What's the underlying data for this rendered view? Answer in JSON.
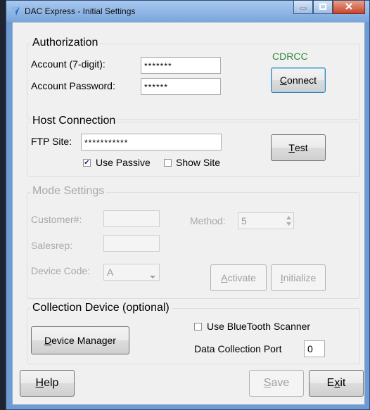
{
  "window": {
    "title": "DAC Express - Initial Settings"
  },
  "authorization": {
    "group_title": "Authorization",
    "account_label": "Account (7-digit):",
    "account_value": "*******",
    "password_label": "Account Password:",
    "password_value": "******",
    "status_text": "CDRCC",
    "connect_button": {
      "mnemonic": "C",
      "rest": "onnect"
    }
  },
  "host": {
    "group_title": "Host Connection",
    "ftp_label": "FTP Site:",
    "ftp_value": "***********",
    "use_passive_label": "Use Passive",
    "use_passive_checked": true,
    "show_site_label": "Show Site",
    "show_site_checked": false,
    "test_button": {
      "mnemonic": "T",
      "rest": "est"
    }
  },
  "mode": {
    "group_title": "Mode Settings",
    "customer_label": "Customer#:",
    "customer_value": "",
    "salesrep_label": "Salesrep:",
    "salesrep_value": "",
    "method_label": "Method:",
    "method_value": "5",
    "device_code_label": "Device Code:",
    "device_code_value": "A",
    "activate_button": {
      "mnemonic": "A",
      "rest": "ctivate"
    },
    "initialize_button": {
      "mnemonic": "I",
      "rest": "nitialize"
    }
  },
  "collection": {
    "group_title": "Collection Device (optional)",
    "device_manager_button": {
      "mnemonic": "D",
      "rest": "evice Manager"
    },
    "bluetooth_label": "Use BlueTooth Scanner",
    "bluetooth_checked": false,
    "port_label": "Data Collection Port",
    "port_value": "0"
  },
  "footer": {
    "help_button": {
      "mnemonic": "H",
      "rest": "elp"
    },
    "save_button": {
      "mnemonic": "S",
      "rest": "ave"
    },
    "exit_button": {
      "pre": "E",
      "mnemonic": "x",
      "rest": "it"
    }
  },
  "colors": {
    "status_text": "#2a8a3a",
    "title_bar": "#7aa6dc",
    "close_button": "#c8452c"
  }
}
